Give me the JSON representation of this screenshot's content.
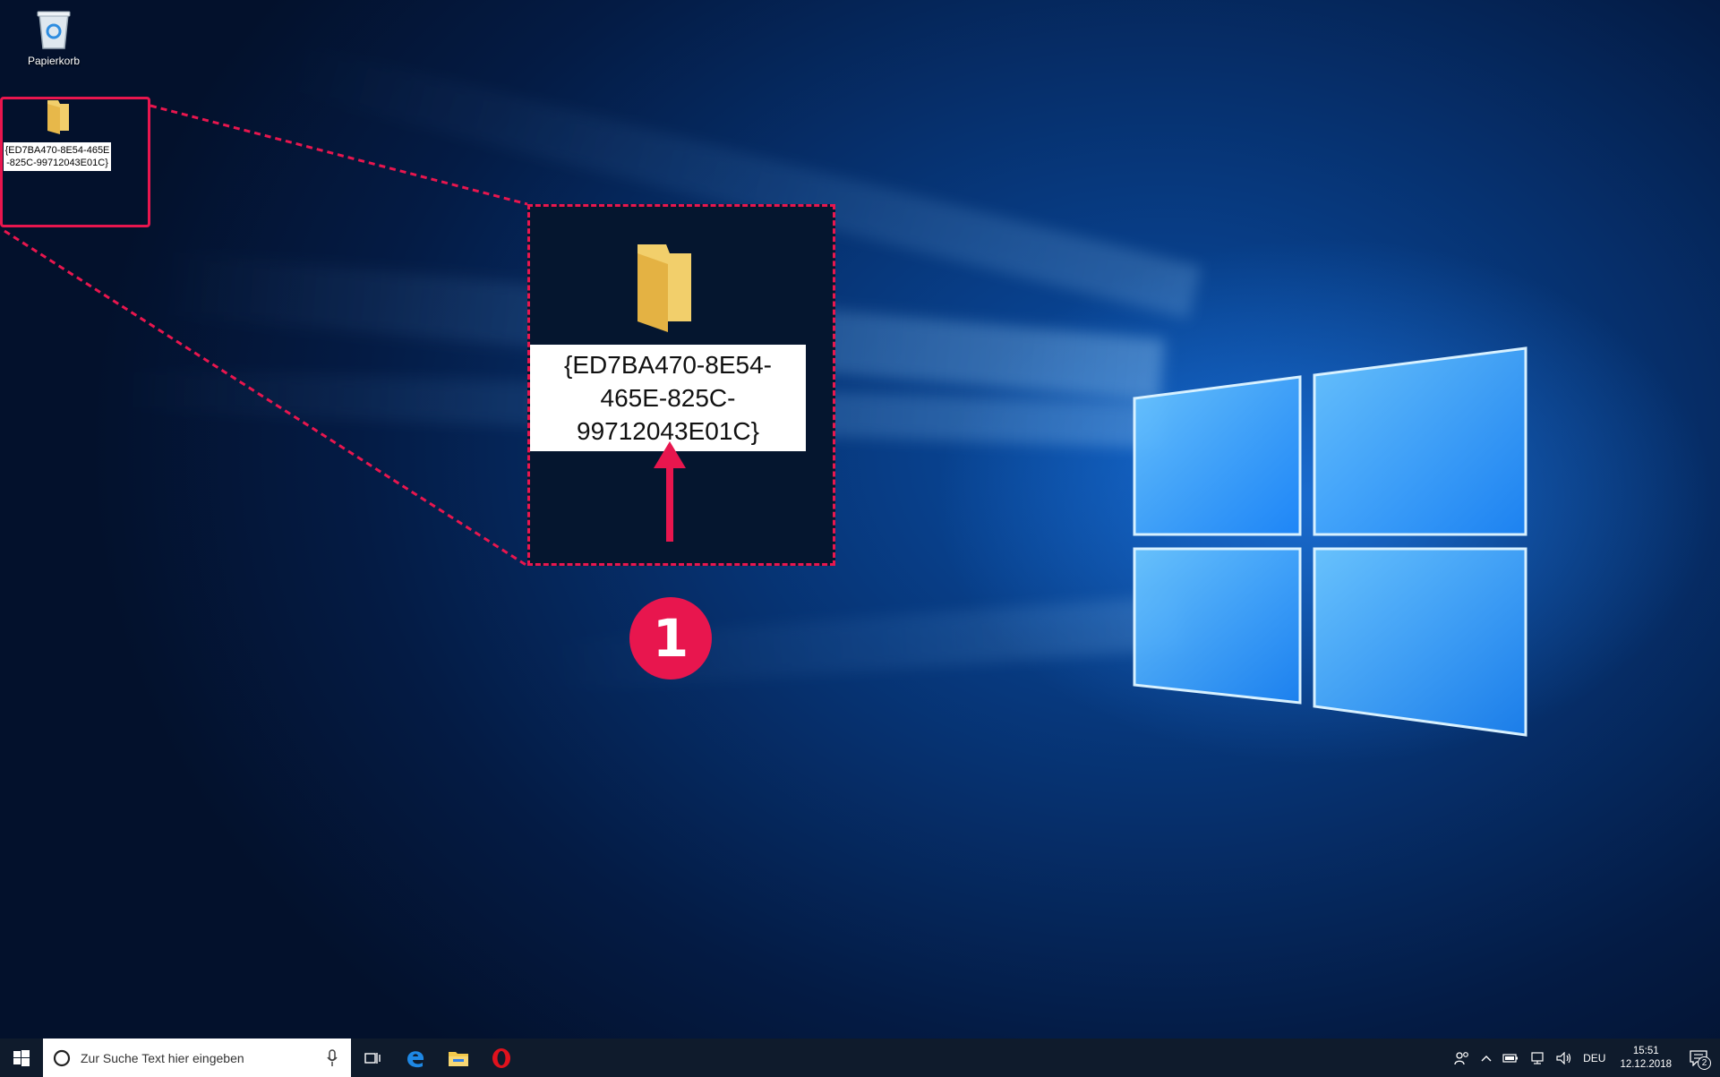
{
  "desktop": {
    "recycle_bin_label": "Papierkorb",
    "folder_rename_small": "{ED7BA470-8E54-465E-825C-99712043E01C}"
  },
  "callout": {
    "rename_text_lines": [
      "{ED7BA470-8E54-",
      "465E-825C-",
      "99712043E01C}"
    ],
    "step_number": "1",
    "accent_color": "#e8164e"
  },
  "taskbar": {
    "search_placeholder": "Zur Suche Text hier eingeben",
    "language": "DEU",
    "time": "15:51",
    "date": "12.12.2018",
    "notification_count": "2",
    "pinned_apps": [
      "edge-icon",
      "file-explorer-icon",
      "opera-icon"
    ]
  }
}
